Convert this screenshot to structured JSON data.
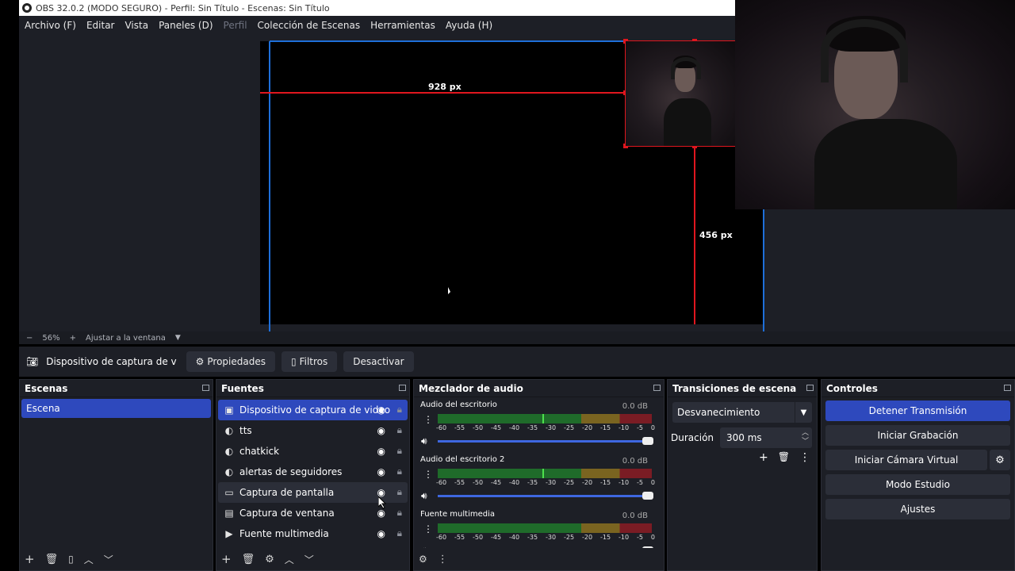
{
  "window": {
    "title": "OBS 32.0.2 (MODO SEGURO) - Perfil: Sin Título - Escenas: Sin Título"
  },
  "menu": {
    "items": [
      "Archivo (F)",
      "Editar",
      "Vista",
      "Paneles (D)",
      "Perfil",
      "Colección de Escenas",
      "Herramientas",
      "Ayuda (H)"
    ]
  },
  "preview": {
    "width_label": "928 px",
    "height_label": "456 px",
    "zoom": "56%",
    "zoom_minus": "−",
    "zoom_plus": "+",
    "fit_label": "Ajustar a la ventana"
  },
  "source_toolbar": {
    "current_source": "Dispositivo de captura de v",
    "properties": "Propiedades",
    "filters": "Filtros",
    "deactivate": "Desactivar"
  },
  "scenes": {
    "title": "Escenas",
    "items": [
      "Escena"
    ]
  },
  "sources": {
    "title": "Fuentes",
    "items": [
      {
        "label": "Dispositivo de captura de video",
        "icon": "camera-icon"
      },
      {
        "label": "tts",
        "icon": "globe-icon"
      },
      {
        "label": "chatkick",
        "icon": "globe-icon"
      },
      {
        "label": "alertas de seguidores",
        "icon": "globe-icon"
      },
      {
        "label": "Captura de pantalla",
        "icon": "monitor-icon"
      },
      {
        "label": "Captura de ventana",
        "icon": "window-icon"
      },
      {
        "label": "Fuente multimedia",
        "icon": "play-icon"
      }
    ]
  },
  "mixer": {
    "title": "Mezclador de audio",
    "channels": [
      {
        "name": "Audio del escritorio",
        "db": "0.0 dB",
        "level": 0.49
      },
      {
        "name": "Audio del escritorio 2",
        "db": "0.0 dB",
        "level": 0.49
      },
      {
        "name": "Fuente multimedia",
        "db": "0.0 dB",
        "level": 0
      }
    ],
    "ticks": [
      "-60",
      "-55",
      "-50",
      "-45",
      "-40",
      "-35",
      "-30",
      "-25",
      "-20",
      "-15",
      "-10",
      "-5",
      "0"
    ]
  },
  "transitions": {
    "title": "Transiciones de escena",
    "selected": "Desvanecimiento",
    "duration_label": "Duración",
    "duration_value": "300 ms"
  },
  "controls": {
    "title": "Controles",
    "stop_stream": "Detener Transmisión",
    "start_recording": "Iniciar Grabación",
    "start_virtual_cam": "Iniciar Cámara Virtual",
    "studio_mode": "Modo Estudio",
    "settings": "Ajustes"
  },
  "colors": {
    "accent": "#2e49bd",
    "panel": "#1d1f26",
    "guide_red": "#e0161e",
    "bounds_blue": "#1e6fd9"
  }
}
